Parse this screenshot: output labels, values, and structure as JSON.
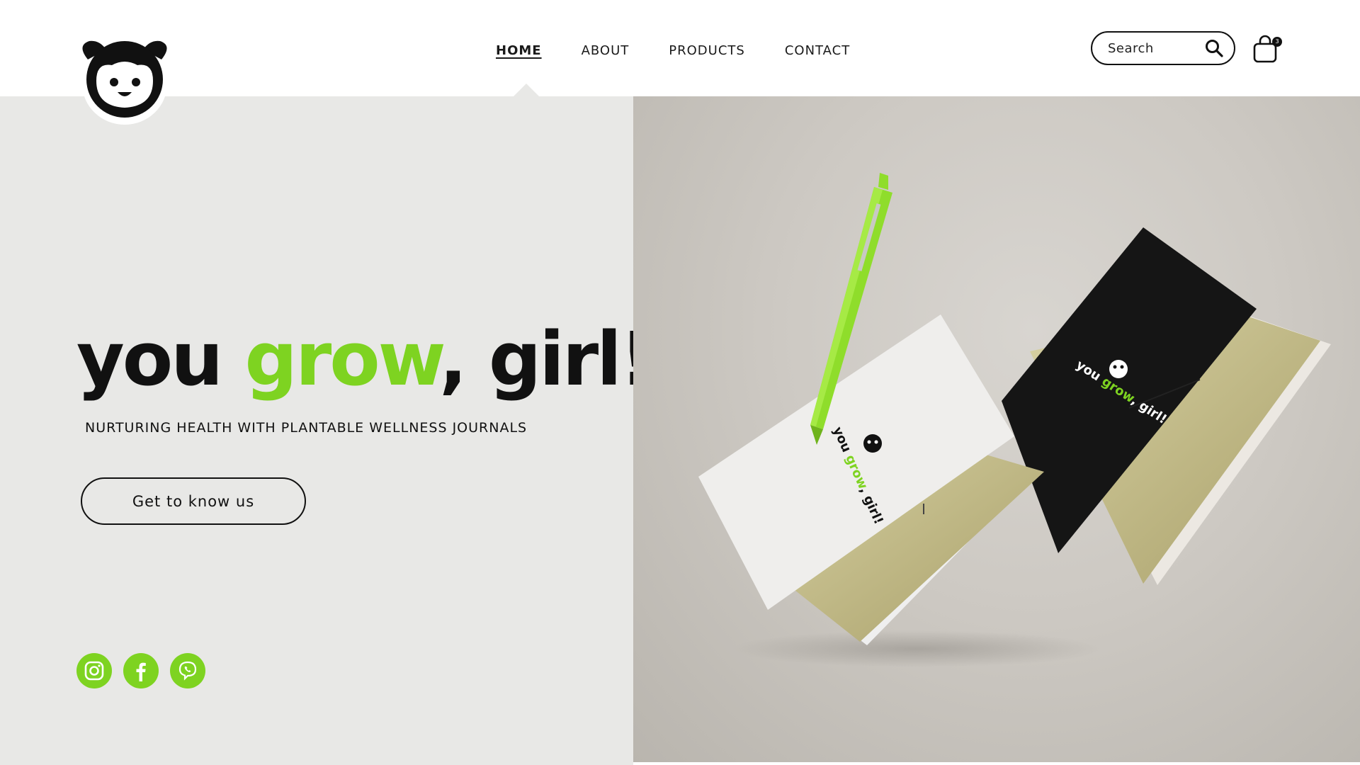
{
  "brand": {
    "logo_icon": "girl-face-logo-icon",
    "accent_color": "#7ed321",
    "panel_color": "#e8e8e6"
  },
  "nav": {
    "items": [
      {
        "label": "HOME",
        "active": true
      },
      {
        "label": "ABOUT",
        "active": false
      },
      {
        "label": "PRODUCTS",
        "active": false
      },
      {
        "label": "CONTACT",
        "active": false
      }
    ]
  },
  "search": {
    "placeholder": "Search",
    "icon": "search-icon"
  },
  "cart": {
    "icon": "shopping-bag-icon",
    "count": "3"
  },
  "hero": {
    "title_part1": "you ",
    "title_green": "grow",
    "title_part2": ", girl!",
    "subtitle": "NURTURING HEALTH WITH PLANTABLE WELLNESS JOURNALS",
    "cta_label": "Get to know us"
  },
  "product_image": {
    "pen_color": "#8fdd2b",
    "journal_white_brand": "you grow, girl!",
    "journal_black_brand": "you grow, girl!"
  },
  "socials": [
    {
      "name": "instagram-icon"
    },
    {
      "name": "facebook-icon"
    },
    {
      "name": "viber-icon"
    }
  ],
  "carousel": {
    "slides": 3,
    "active_index": 0
  }
}
